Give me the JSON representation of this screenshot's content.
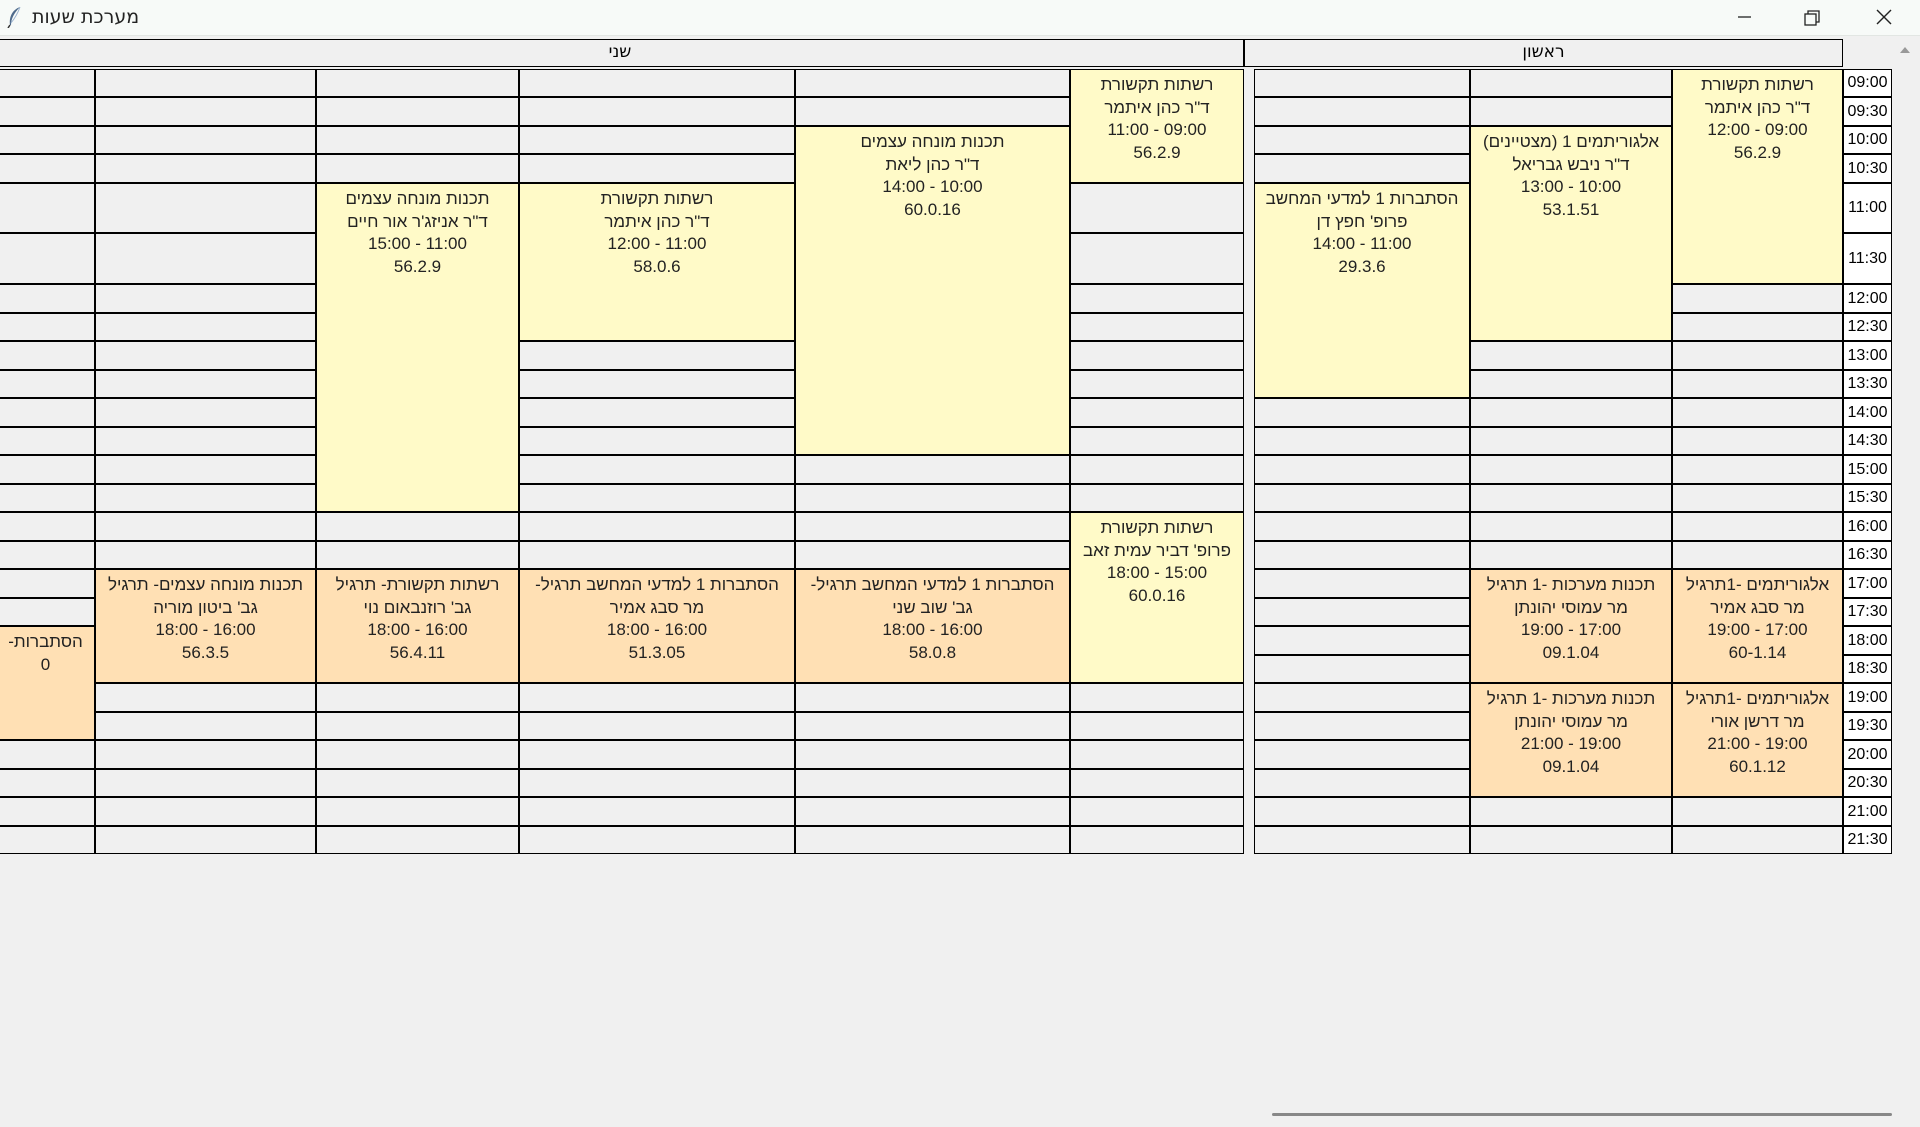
{
  "window": {
    "title": "מערכת שעות",
    "icons": {
      "app": "feather-icon",
      "minimize": "minimize-icon",
      "restore": "restore-icon",
      "close": "close-icon"
    }
  },
  "days": [
    "ראשון",
    "שני"
  ],
  "times": [
    "09:00",
    "09:30",
    "10:00",
    "10:30",
    "11:00",
    "11:30",
    "12:00",
    "12:30",
    "13:00",
    "13:30",
    "14:00",
    "14:30",
    "15:00",
    "15:30",
    "16:00",
    "16:30",
    "17:00",
    "17:30",
    "18:00",
    "18:30",
    "19:00",
    "19:30",
    "20:00",
    "20:30",
    "21:00",
    "21:30"
  ],
  "colors": {
    "lecture": "#fffac8",
    "exercise": "#ffe0b4"
  },
  "blocks": [
    {
      "type": "lecture",
      "day": "ראשון",
      "course": "רשתות תקשורת",
      "instructor": "ד\"ר כהן איתמר",
      "time": "12:00 - 09:00",
      "room": "56.2.9"
    },
    {
      "type": "lecture",
      "day": "ראשון",
      "course": "אלגוריתמים 1 (מצטיינים)",
      "instructor": "ד\"ר ניבש גבריאל",
      "time": "13:00 - 10:00",
      "room": "53.1.51"
    },
    {
      "type": "lecture",
      "day": "ראשון",
      "course": "הסתברות 1 למדעי המחשב",
      "instructor": "פרופ' חפץ דן",
      "time": "14:00 - 11:00",
      "room": "29.3.6"
    },
    {
      "type": "exercise",
      "day": "ראשון",
      "course": "אלגוריתמים -1תרגיל",
      "instructor": "מר סבג אמיר",
      "time": "19:00 - 17:00",
      "room": "60-1.14"
    },
    {
      "type": "exercise",
      "day": "ראשון",
      "course": "תכנות מערכות -1 תרגיל",
      "instructor": "מר עמוסי יהונתן",
      "time": "19:00 - 17:00",
      "room": "09.1.04"
    },
    {
      "type": "exercise",
      "day": "ראשון",
      "course": "אלגוריתמים -1תרגיל",
      "instructor": "מר דרשן אורי",
      "time": "21:00 - 19:00",
      "room": "60.1.12"
    },
    {
      "type": "exercise",
      "day": "ראשון",
      "course": "תכנות מערכות -1 תרגיל",
      "instructor": "מר עמוסי יהונתן",
      "time": "21:00 - 19:00",
      "room": "09.1.04"
    },
    {
      "type": "lecture",
      "day": "שני",
      "course": "רשתות תקשורת",
      "instructor": "ד\"ר כהן איתמר",
      "time": "11:00 - 09:00",
      "room": "56.2.9"
    },
    {
      "type": "lecture",
      "day": "שני",
      "course": "תכנות מונחה עצמים",
      "instructor": "ד\"ר כהן ליאת",
      "time": "14:00 - 10:00",
      "room": "60.0.16"
    },
    {
      "type": "lecture",
      "day": "שני",
      "course": "רשתות תקשורת",
      "instructor": "ד\"ר כהן איתמר",
      "time": "12:00 - 11:00",
      "room": "58.0.6"
    },
    {
      "type": "lecture",
      "day": "שני",
      "course": "תכנות מונחה עצמים",
      "instructor": "ד\"ר אניזג'ר אור חיים",
      "time": "15:00 - 11:00",
      "room": "56.2.9"
    },
    {
      "type": "lecture",
      "day": "שני",
      "course": "רשתות תקשורת",
      "instructor": "פרופ' דביר עמית זאב",
      "time": "18:00 - 15:00",
      "room": "60.0.16"
    },
    {
      "type": "exercise",
      "day": "שני",
      "course": "-הסתברות 1 למדעי המחשב תרגיל",
      "instructor": "גב' שוב שני",
      "time": "18:00 - 16:00",
      "room": "58.0.8"
    },
    {
      "type": "exercise",
      "day": "שני",
      "course": "-הסתברות 1 למדעי המחשב תרגיל",
      "instructor": "מר סבג אמיר",
      "time": "18:00 - 16:00",
      "room": "51.3.05"
    },
    {
      "type": "exercise",
      "day": "שני",
      "course": "רשתות תקשורת- תרגיל",
      "instructor": "גב' רוזנבאום נוי",
      "time": "18:00 - 16:00",
      "room": "56.4.11"
    },
    {
      "type": "exercise",
      "day": "שני",
      "course": "תכנות מונחה עצמים- תרגיל",
      "instructor": "גב' ביטון מוריה",
      "time": "18:00 - 16:00",
      "room": "56.3.5"
    },
    {
      "type": "exercise",
      "day": "שני",
      "course": "-הסתברות",
      "instructor": "",
      "time": "",
      "room": "0"
    }
  ]
}
